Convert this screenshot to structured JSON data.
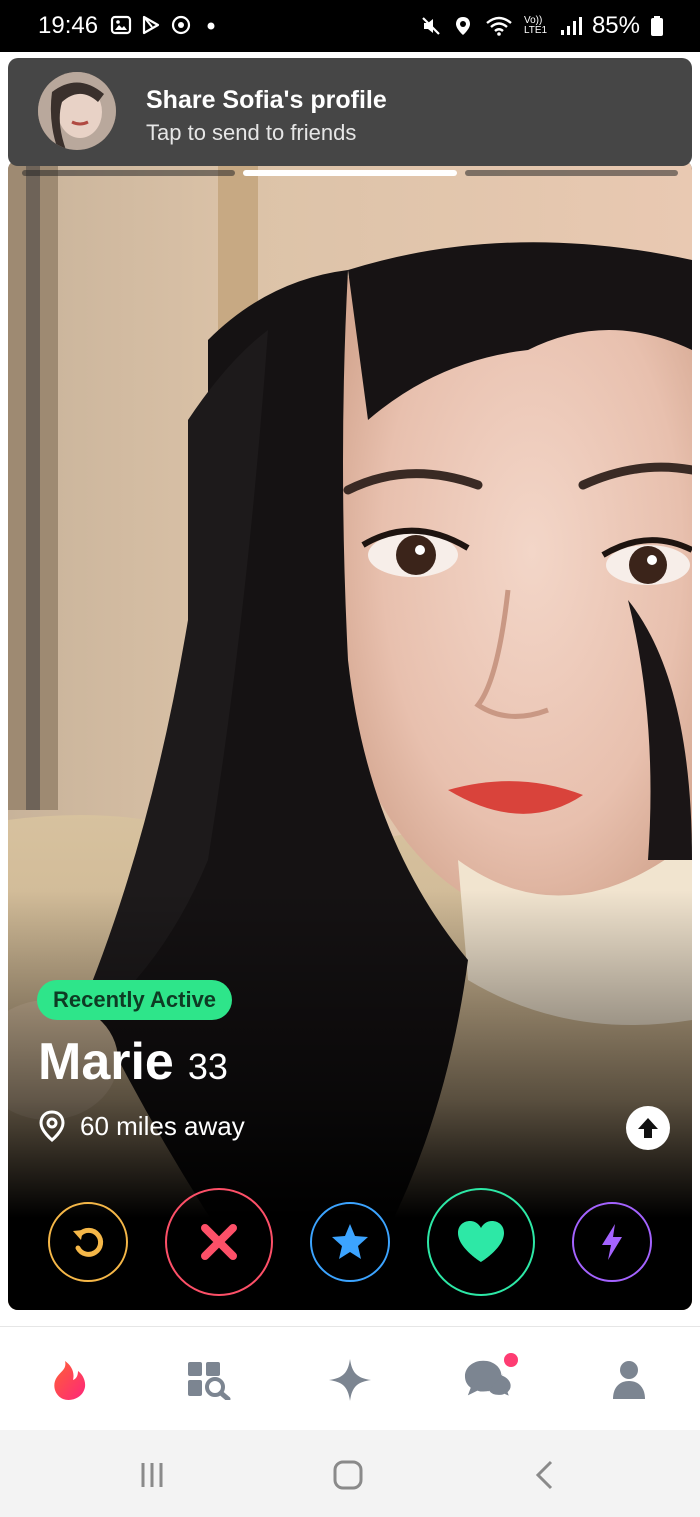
{
  "status_bar": {
    "time": "19:46",
    "battery": "85%",
    "network_label": "Vo)) LTE1"
  },
  "share_banner": {
    "title": "Share Sofia's profile",
    "subtitle": "Tap to send to friends"
  },
  "card": {
    "photo_index": 2,
    "photo_count": 3,
    "badge": "Recently Active",
    "name": "Marie",
    "age": "33",
    "distance": "60 miles away"
  },
  "actions": [
    {
      "name": "rewind-button",
      "icon": "rewind-icon",
      "color": "#f5b748"
    },
    {
      "name": "nope-button",
      "icon": "close-icon",
      "color": "#fd5068"
    },
    {
      "name": "super-like-button",
      "icon": "star-icon",
      "color": "#3ca4ff"
    },
    {
      "name": "like-button",
      "icon": "heart-icon",
      "color": "#2de8a6"
    },
    {
      "name": "boost-button",
      "icon": "lightning-icon",
      "color": "#a463ff"
    }
  ],
  "bottom_nav": {
    "active": "discover",
    "items": [
      "discover",
      "explore",
      "gold-home",
      "messages",
      "profile"
    ],
    "messages_has_notification": true
  },
  "colors": {
    "brand": "#fe3c72",
    "badge_green": "#2ee58a",
    "nav_icon": "#7c8591"
  }
}
